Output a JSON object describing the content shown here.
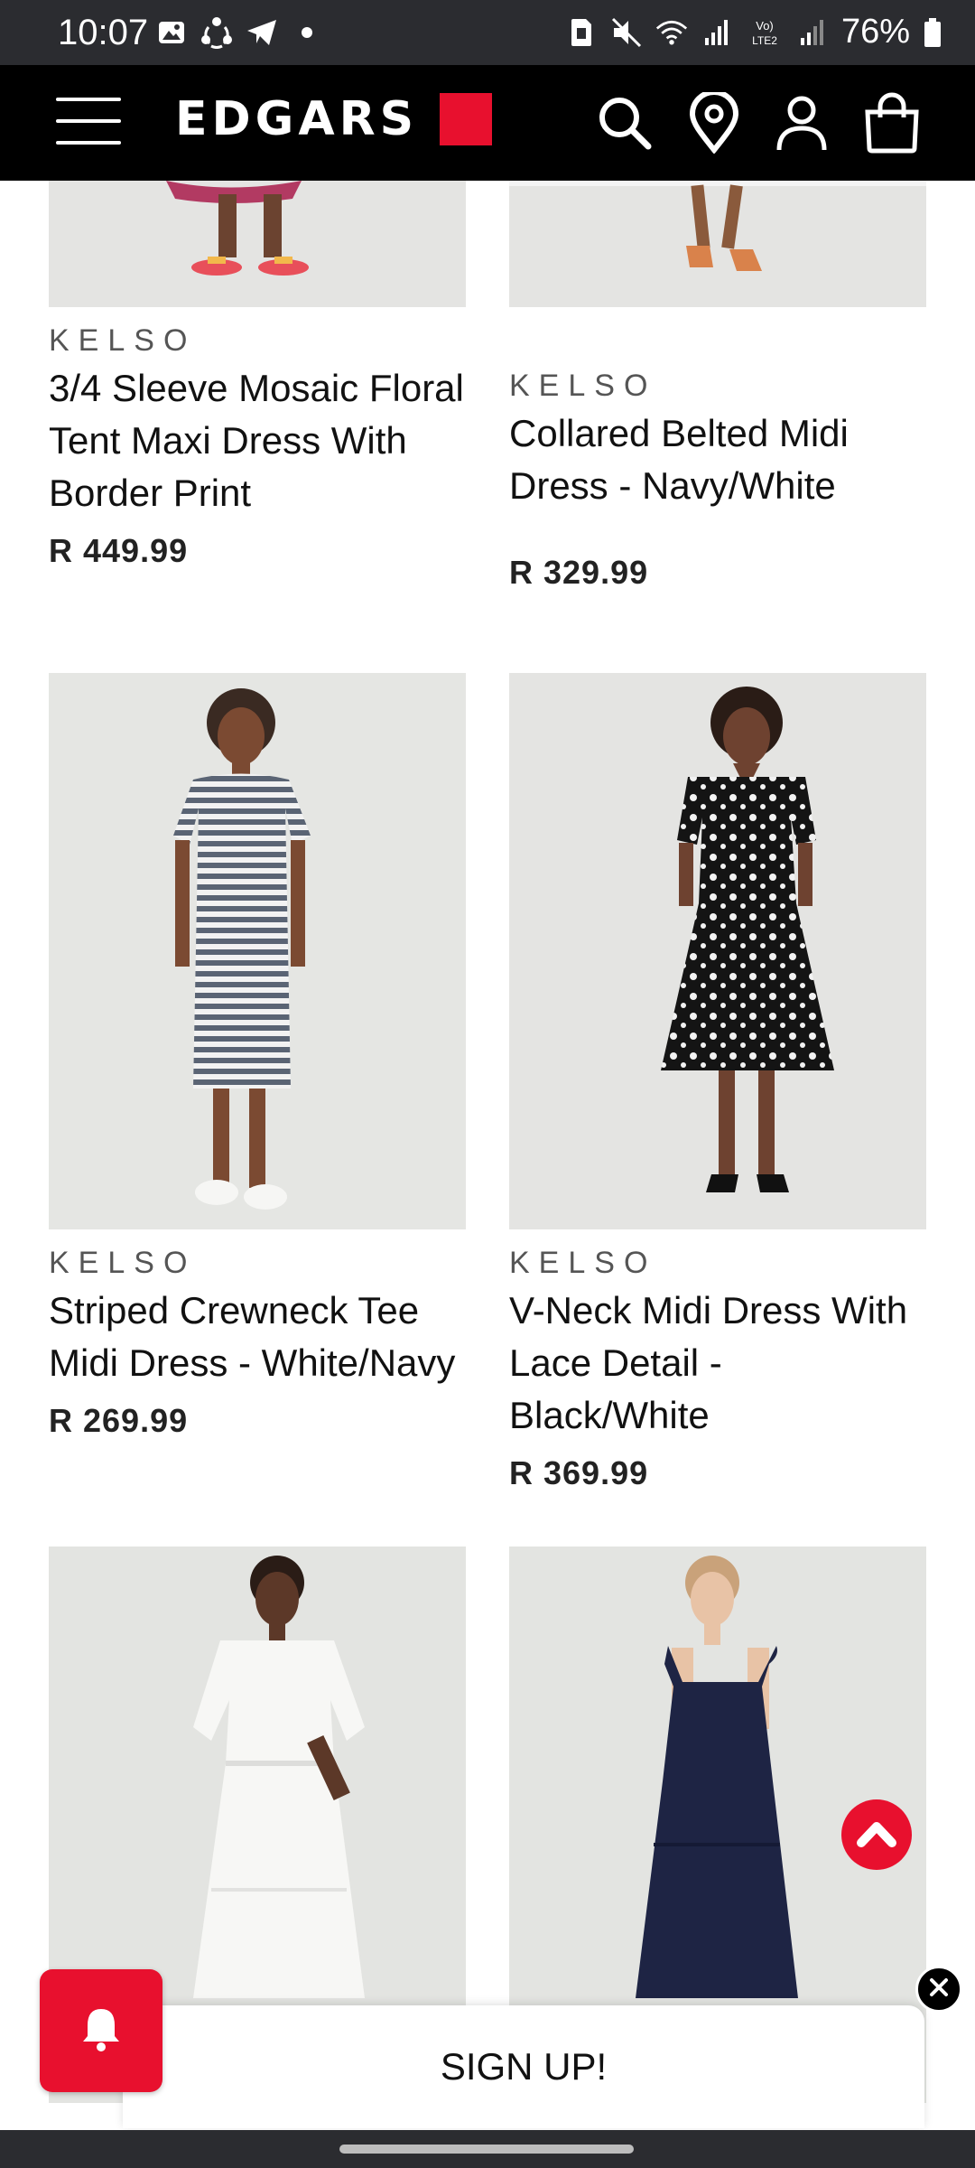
{
  "status_bar": {
    "time": "10:07",
    "battery": "76%",
    "left_icons": [
      "image-icon",
      "sync-icon",
      "telegram-icon",
      "dot-icon"
    ],
    "right_icons": [
      "sim-icon",
      "mute-icon",
      "wifi-icon",
      "signal-icon",
      "volte-icon",
      "signal-icon",
      "battery-icon"
    ]
  },
  "header": {
    "logo_text": "EDGARS",
    "brand_color": "#e8102e"
  },
  "products": [
    {
      "brand": "KELSO",
      "name": "3/4 Sleeve Mosaic Floral Tent Maxi Dress With Border Print",
      "price": "R 449.99"
    },
    {
      "brand": "KELSO",
      "name": "Collared Belted Midi Dress - Navy/White",
      "price": "R 329.99"
    },
    {
      "brand": "KELSO",
      "name": "Striped Crewneck Tee Midi Dress - White/Navy",
      "price": "R 269.99"
    },
    {
      "brand": "KELSO",
      "name": "V-Neck Midi Dress With Lace Detail - Black/White",
      "price": "R 369.99"
    },
    {
      "brand": "",
      "name": "",
      "price": ""
    },
    {
      "brand": "",
      "name": "",
      "price": ""
    }
  ],
  "signup": {
    "label": "SIGN UP!"
  }
}
